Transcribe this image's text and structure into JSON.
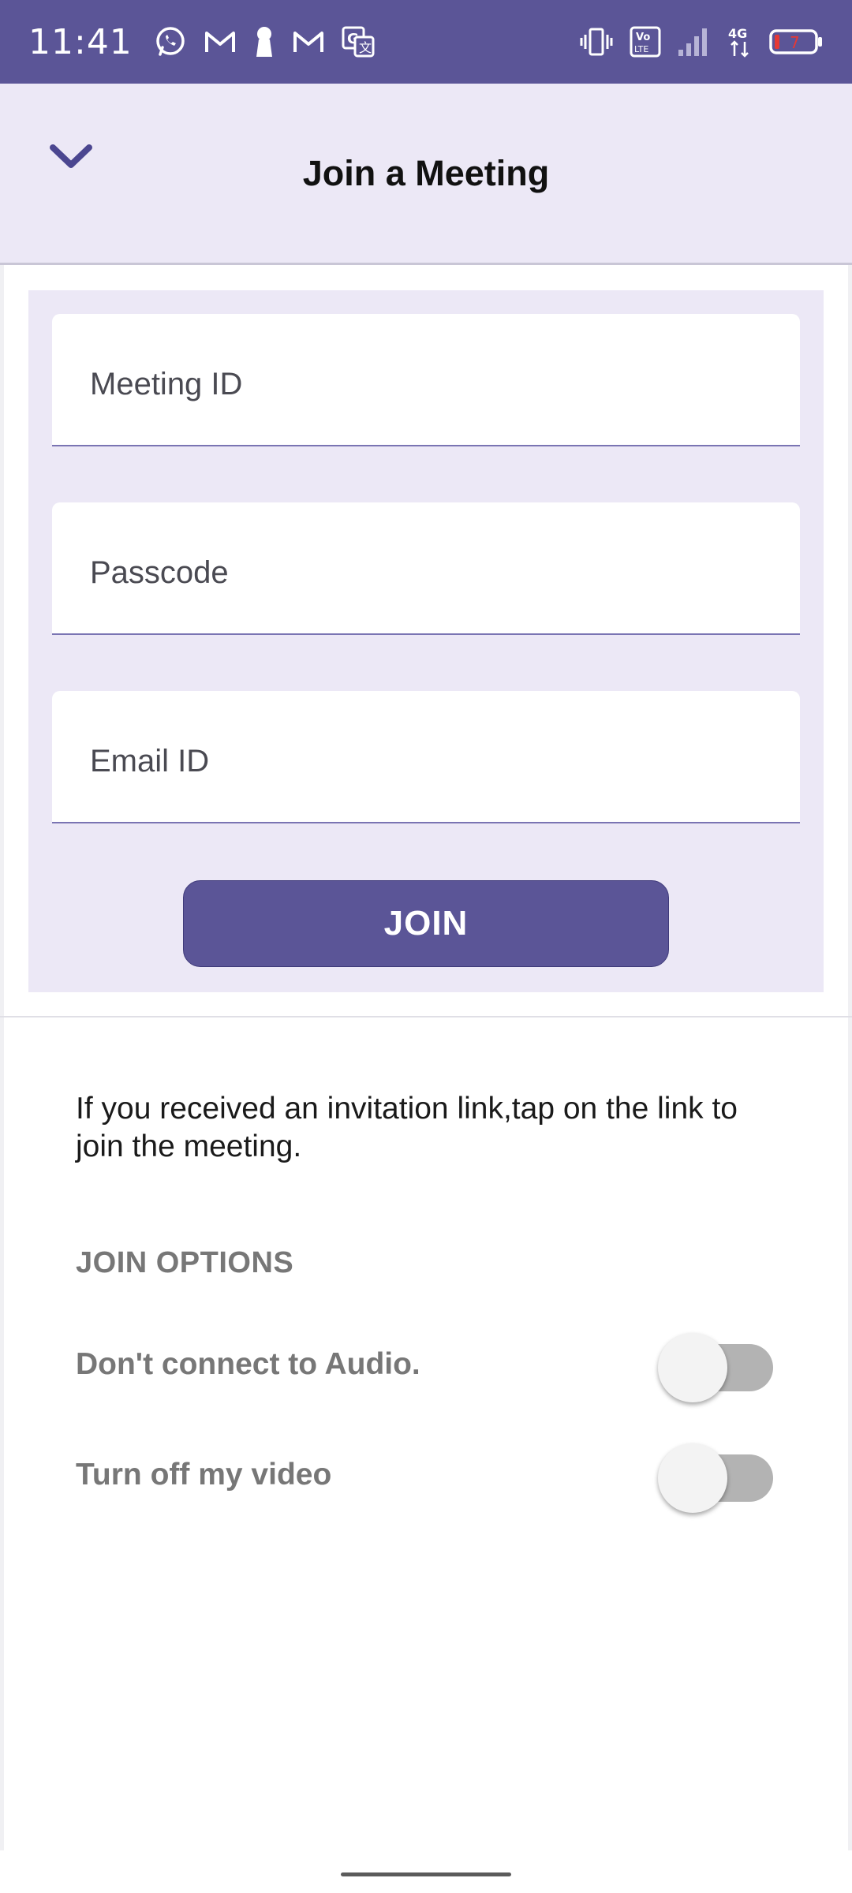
{
  "status_bar": {
    "time": "11:41",
    "left_icons": [
      "whatsapp-icon",
      "gmail-icon",
      "keyhole-icon",
      "gmail-icon",
      "translate-icon"
    ],
    "right_icons": [
      "vibrate-icon",
      "volte-icon",
      "signal-icon",
      "4g-icon",
      "battery-icon"
    ],
    "network_label": "4G",
    "volte_label": "VoLTE",
    "battery_level": "7"
  },
  "header": {
    "title": "Join a Meeting",
    "back_icon": "chevron-down-icon"
  },
  "form": {
    "meeting_id": {
      "placeholder": "Meeting ID",
      "value": ""
    },
    "passcode": {
      "placeholder": "Passcode",
      "value": ""
    },
    "email": {
      "placeholder": "Email ID",
      "value": ""
    },
    "join_label": "JOIN"
  },
  "info": {
    "text": "If you received an invitation link,tap on the link to join the meeting."
  },
  "join_options": {
    "heading": "JOIN OPTIONS",
    "options": [
      {
        "label": "Don't connect to Audio.",
        "enabled": false
      },
      {
        "label": "Turn off my video",
        "enabled": false
      }
    ]
  },
  "colors": {
    "primary": "#5b5597",
    "panel_bg": "#ece8f6",
    "toggle_track": "#b3b3b3"
  }
}
